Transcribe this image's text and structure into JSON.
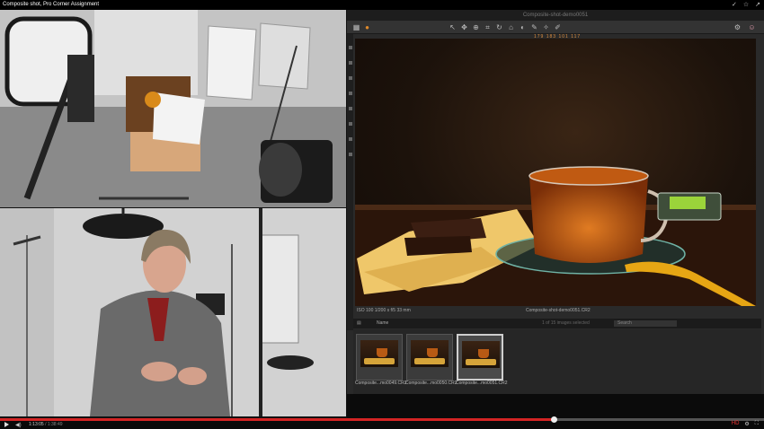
{
  "window": {
    "title": "Composite shot, Pro Corner Assignment"
  },
  "top_icons": [
    "✓",
    "☆",
    "↗"
  ],
  "capture_one": {
    "title": "Composite-shot-demo0051",
    "counts": "179 183 101 117",
    "viewer": {
      "exif": "ISO 100   1/200 s   f/5   33 mm",
      "filename": "Composite-shot-demo0051.CR2"
    },
    "browser": {
      "sort_label": "Name",
      "count_text": "1 of 15 images selected",
      "search_placeholder": "Search"
    },
    "thumbnails": [
      {
        "label": "Composite...mo0049.CR2",
        "selected": false
      },
      {
        "label": "Composite...mo0050.CR2",
        "selected": false
      },
      {
        "label": "Composite...mo0051.CR2",
        "selected": true
      }
    ]
  },
  "player": {
    "current_time": "1:13:05",
    "duration": "1:38:49",
    "progress": 0.725,
    "accent": "#d42424"
  }
}
